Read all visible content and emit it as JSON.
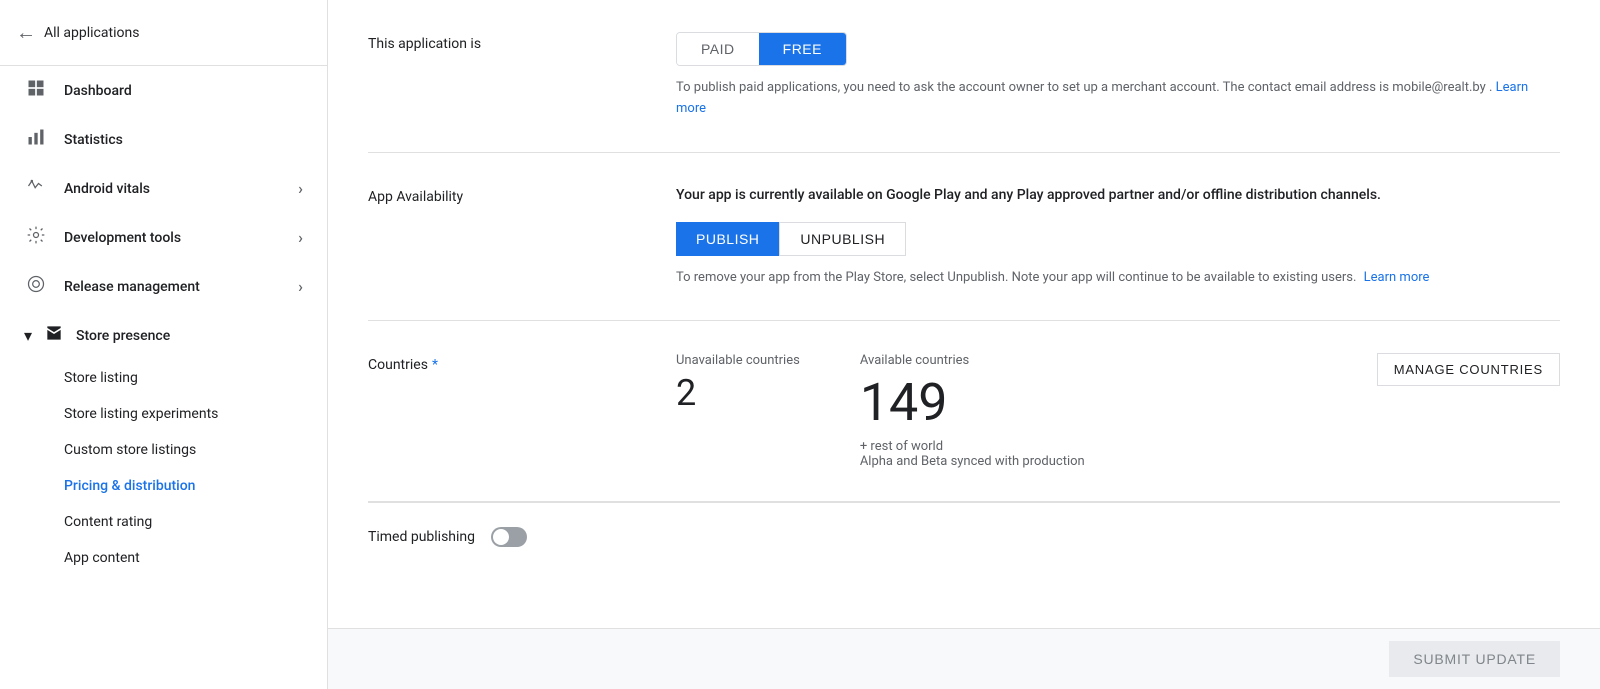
{
  "sidebar": {
    "back_label": "All applications",
    "nav_items": [
      {
        "id": "dashboard",
        "label": "Dashboard",
        "icon": "⊞"
      },
      {
        "id": "statistics",
        "label": "Statistics",
        "icon": "📊"
      },
      {
        "id": "android-vitals",
        "label": "Android vitals",
        "icon": "〜",
        "expandable": true
      },
      {
        "id": "development-tools",
        "label": "Development tools",
        "icon": "⚙",
        "expandable": true
      },
      {
        "id": "release-management",
        "label": "Release management",
        "icon": "🚀",
        "expandable": true
      }
    ],
    "store_presence": {
      "label": "Store presence",
      "sub_items": [
        {
          "id": "store-listing",
          "label": "Store listing",
          "active": false
        },
        {
          "id": "store-listing-experiments",
          "label": "Store listing experiments",
          "active": false
        },
        {
          "id": "custom-store-listings",
          "label": "Custom store listings",
          "active": false
        },
        {
          "id": "pricing-distribution",
          "label": "Pricing & distribution",
          "active": true
        },
        {
          "id": "content-rating",
          "label": "Content rating",
          "active": false
        },
        {
          "id": "app-content",
          "label": "App content",
          "active": false
        }
      ]
    }
  },
  "content": {
    "application_is_label": "This application is",
    "paid_label": "PAID",
    "free_label": "FREE",
    "paid_info": "To publish paid applications, you need to ask the account owner to set up a merchant account. The contact email address is mobile@realt.by .",
    "learn_more_label": "Learn more",
    "app_availability_label": "App Availability",
    "availability_text": "Your app is currently available on Google Play and any Play approved partner and/or offline distribution channels.",
    "publish_label": "PUBLISH",
    "unpublish_label": "UNPUBLISH",
    "unpublish_info": "To remove your app from the Play Store, select Unpublish. Note your app will continue to be available to existing users.",
    "unpublish_learn_more": "Learn more",
    "countries_label": "Countries",
    "countries_required": "*",
    "unavailable_countries_label": "Unavailable countries",
    "unavailable_count": "2",
    "available_countries_label": "Available countries",
    "available_count": "149",
    "rest_of_world": "+ rest of world",
    "alpha_beta_synced": "Alpha and Beta synced with production",
    "manage_countries_label": "MANAGE COUNTRIES",
    "timed_publishing_label": "Timed publishing",
    "submit_update_label": "SUBMIT UPDATE"
  }
}
